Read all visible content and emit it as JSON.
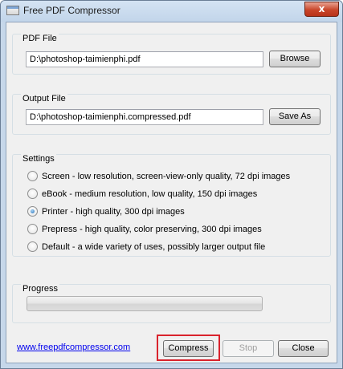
{
  "window": {
    "title": "Free PDF Compressor",
    "close_glyph": "x"
  },
  "pdf_file": {
    "label": "PDF File",
    "value": "D:\\photoshop-taimienphi.pdf",
    "browse_label": "Browse"
  },
  "output_file": {
    "label": "Output File",
    "value": "D:\\photoshop-taimienphi.compressed.pdf",
    "save_as_label": "Save As"
  },
  "settings": {
    "label": "Settings",
    "options": [
      {
        "label": "Screen - low resolution, screen-view-only quality, 72 dpi images",
        "checked": false
      },
      {
        "label": "eBook - medium resolution, low quality, 150 dpi images",
        "checked": false
      },
      {
        "label": "Printer - high quality, 300 dpi images",
        "checked": true
      },
      {
        "label": "Prepress - high quality, color preserving, 300 dpi images",
        "checked": false
      },
      {
        "label": "Default - a wide variety of uses, possibly larger output file",
        "checked": false
      }
    ]
  },
  "progress": {
    "label": "Progress",
    "value": 0
  },
  "footer": {
    "link_text": "www.freepdfcompressor.com",
    "compress_label": "Compress",
    "stop_label": "Stop",
    "close_label": "Close"
  },
  "colors": {
    "highlight": "#d9232d",
    "link": "#0000ee"
  }
}
